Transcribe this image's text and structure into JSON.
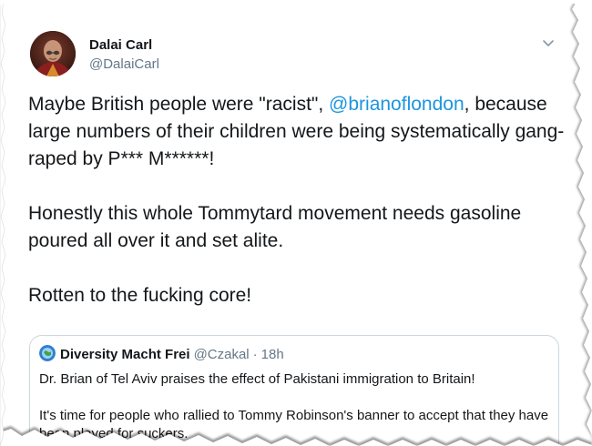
{
  "author": {
    "display_name": "Dalai Carl",
    "handle": "@DalaiCarl",
    "avatar_icon": "profile-photo"
  },
  "menu": {
    "icon": "chevron-down-icon"
  },
  "tweet": {
    "line1_prefix": "Maybe British people were \"racist\", ",
    "mention": "@brianoflondon",
    "line1_suffix": ",",
    "rest_para1": "because large numbers of their children were being systematically gang-raped by P*** M******!",
    "para2": "Honestly this whole Tommytard movement needs gasoline poured all over it and set alite.",
    "para3": "Rotten to the fucking core!"
  },
  "quoted_tweet": {
    "display_name": "Diversity Macht Frei",
    "handle": "@Czakal",
    "separator": "·",
    "time": "18h",
    "para1": "Dr. Brian of Tel Aviv praises the effect of Pakistani immigration to Britain!",
    "para2": "It's time for people who rallied to Tommy Robinson's banner to accept that they have been played for suckers."
  },
  "colors": {
    "link": "#1b95e0",
    "text": "#14171a",
    "secondary": "#657786",
    "border": "#ccd6dd"
  }
}
